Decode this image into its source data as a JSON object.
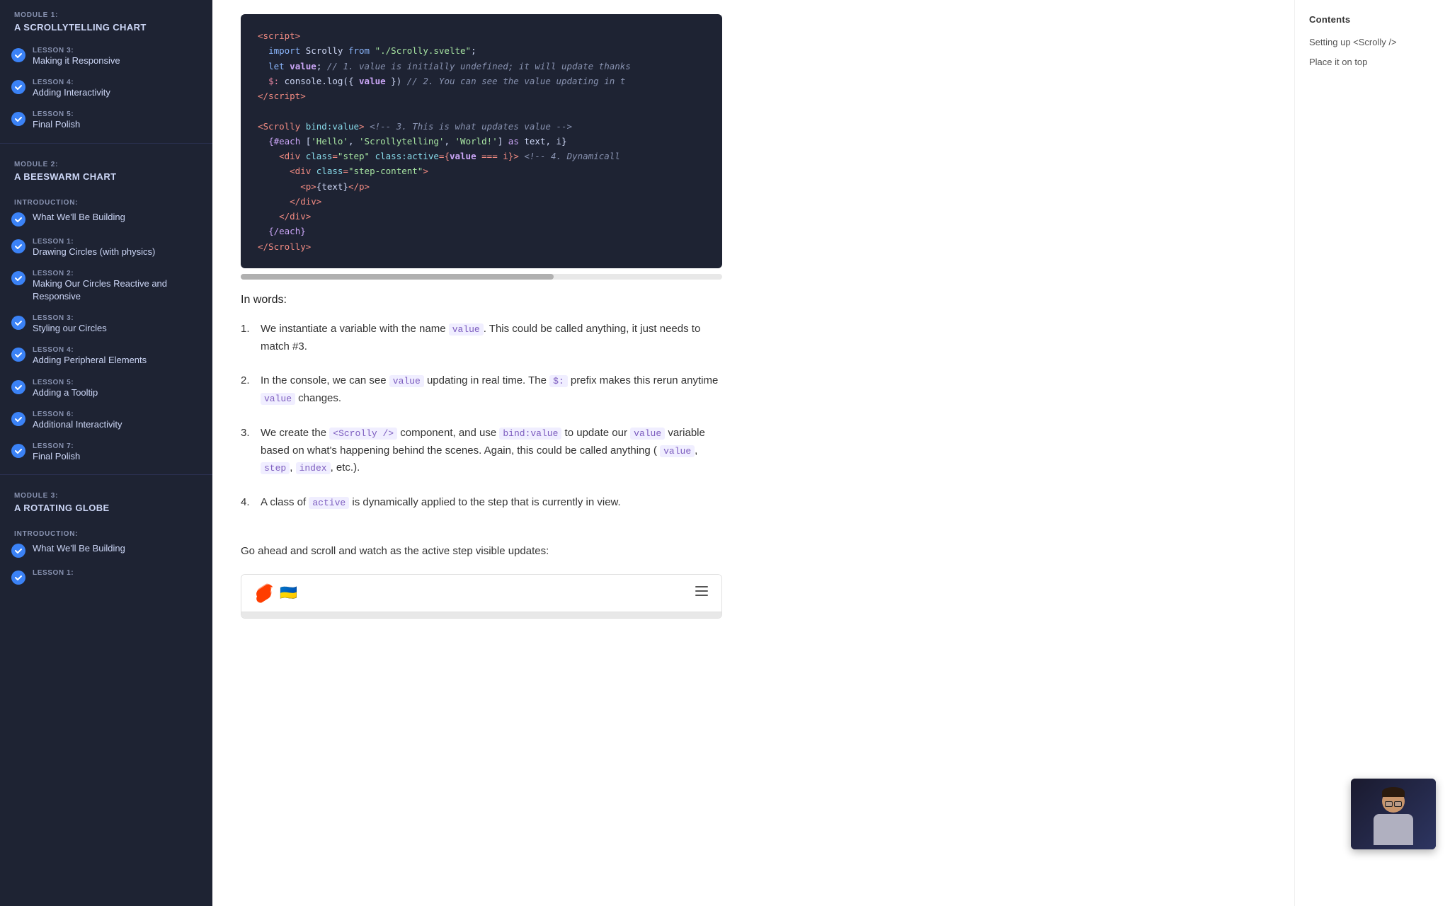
{
  "sidebar": {
    "modules": [
      {
        "id": "module1",
        "module_label": "MODULE 1:",
        "module_title": "A SCROLLYTELLING CHART",
        "intro": null,
        "lessons": [
          {
            "number": "LESSON 3:",
            "name": "Making it Responsive",
            "completed": true
          },
          {
            "number": "LESSON 4:",
            "name": "Adding Interactivity",
            "completed": true
          },
          {
            "number": "LESSON 5:",
            "name": "Final Polish",
            "completed": true
          }
        ]
      },
      {
        "id": "module2",
        "module_label": "MODULE 2:",
        "module_title": "A BEESWARM CHART",
        "intro": null,
        "lessons": [
          {
            "number": "INTRODUCTION:",
            "name": "What We'll Be Building",
            "completed": true
          },
          {
            "number": "LESSON 1:",
            "name": "Drawing Circles (with physics)",
            "completed": true
          },
          {
            "number": "LESSON 2:",
            "name": "Making Our Circles Reactive and Responsive",
            "completed": true
          },
          {
            "number": "LESSON 3:",
            "name": "Styling our Circles",
            "completed": true
          },
          {
            "number": "LESSON 4:",
            "name": "Adding Peripheral Elements",
            "completed": true
          },
          {
            "number": "LESSON 5:",
            "name": "Adding a Tooltip",
            "completed": true
          },
          {
            "number": "LESSON 6:",
            "name": "Additional Interactivity",
            "completed": true
          },
          {
            "number": "LESSON 7:",
            "name": "Final Polish",
            "completed": true
          }
        ]
      },
      {
        "id": "module3",
        "module_label": "MODULE 3:",
        "module_title": "A ROTATING GLOBE",
        "lessons": [
          {
            "number": "INTRODUCTION:",
            "name": "What We'll Be Building",
            "completed": true
          },
          {
            "number": "LESSON 1:",
            "name": "",
            "completed": false
          }
        ]
      }
    ]
  },
  "toc": {
    "title": "Contents",
    "items": [
      {
        "label": "Setting up <Scrolly />"
      },
      {
        "label": "Place it on top"
      }
    ]
  },
  "content": {
    "in_words_label": "In words:",
    "list_items": [
      {
        "num": "1.",
        "text_before": "We instantiate a variable with the name",
        "code1": "value",
        "text_after": ". This could be called anything, it just needs to match #3."
      },
      {
        "num": "2.",
        "text_before": "In the console, we can see",
        "code1": "value",
        "text_mid1": "updating in real time. The",
        "code2": "$:",
        "text_mid2": "prefix makes this rerun anytime",
        "code3": "value",
        "text_after": "changes."
      },
      {
        "num": "3.",
        "text_before": "We create the",
        "code1": "<Scrolly />",
        "text_mid1": "component, and use",
        "code2": "bind:value",
        "text_mid2": "to update our",
        "code3": "value",
        "text_after": "variable based on what's happening behind the scenes. Again, this could be called anything (",
        "code4": "value",
        "code5": "step",
        "code6": "index",
        "text_end": "etc.)."
      },
      {
        "num": "4.",
        "text_before": "A class of",
        "code1": "active",
        "text_after": "is dynamically applied to the step that is currently in view."
      }
    ],
    "go_ahead_text": "Go ahead and scroll and watch as the active step visible updates:",
    "demo": {
      "bottom_bar_label": ""
    }
  },
  "video_thumb": {
    "visible": true
  }
}
